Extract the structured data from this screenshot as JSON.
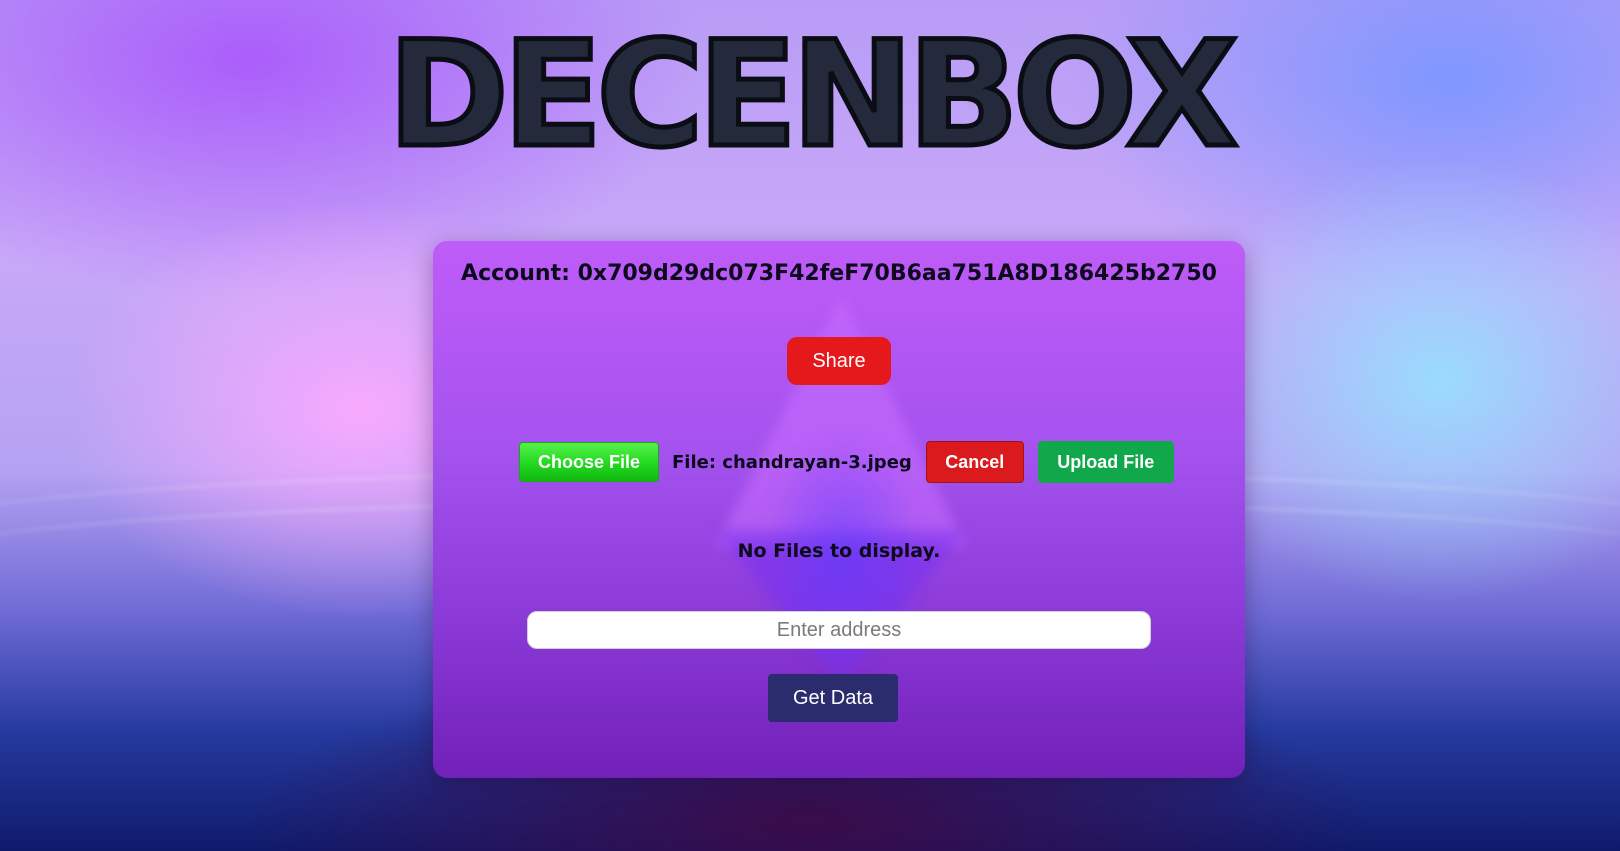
{
  "app": {
    "title": "DECENBOX"
  },
  "account": {
    "label": "Account: 0x709d29dc073F42feF70B6aa751A8D186425b2750"
  },
  "share": {
    "label": "Share"
  },
  "upload": {
    "choose_label": "Choose File",
    "file_label": "File: chandrayan-3.jpeg",
    "cancel_label": "Cancel",
    "upload_label": "Upload File"
  },
  "files": {
    "empty_message": "No Files to display."
  },
  "lookup": {
    "placeholder": "Enter address",
    "value": "",
    "button_label": "Get Data"
  },
  "colors": {
    "share": "#e5191c",
    "choose": "#22d81e",
    "cancel": "#db1a1d",
    "upload": "#11a84c",
    "get_data": "#2a2c6e",
    "card": "#a452ee"
  }
}
